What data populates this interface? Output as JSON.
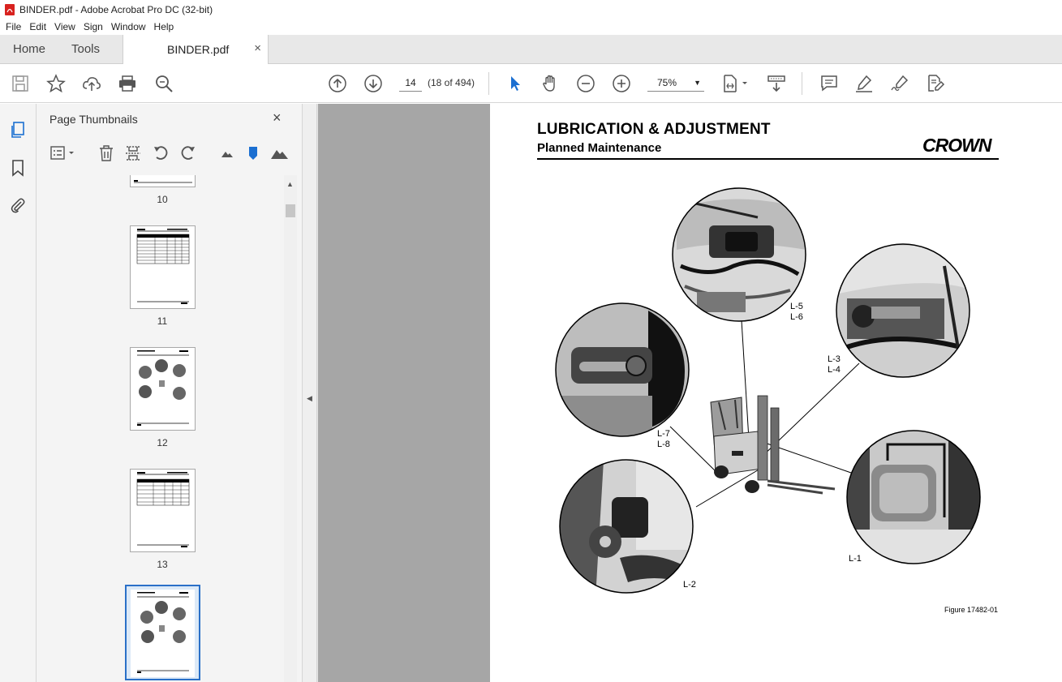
{
  "window": {
    "title": "BINDER.pdf - Adobe Acrobat Pro DC (32-bit)"
  },
  "menu": [
    "File",
    "Edit",
    "View",
    "Sign",
    "Window",
    "Help"
  ],
  "nav_tabs": {
    "home": "Home",
    "tools": "Tools"
  },
  "doc_tab": {
    "name": "BINDER.pdf",
    "close": "×"
  },
  "toolbar": {
    "page_number": "14",
    "page_count": "(18 of 494)",
    "zoom": "75%",
    "icons": [
      "save-icon",
      "star-icon",
      "upload-icon",
      "print-icon",
      "zoom-search-icon",
      "prev-page-icon",
      "next-page-icon",
      "select-cursor-icon",
      "hand-icon",
      "zoom-out-icon",
      "zoom-in-icon",
      "page-layout-icon",
      "scroll-mode-icon",
      "comment-icon",
      "highlight-icon",
      "sign-icon",
      "edit-pdf-icon"
    ]
  },
  "thumbnails_panel": {
    "title": "Page Thumbnails",
    "close": "×",
    "labels": [
      "10",
      "11",
      "12",
      "13"
    ]
  },
  "page": {
    "title": "LUBRICATION & ADJUSTMENT",
    "subtitle": "Planned Maintenance",
    "logo_text": "CROWN",
    "callouts": {
      "l5l6": "L-5\nL-6",
      "l3l4": "L-3\nL-4",
      "l7l8": "L-7\nL-8",
      "l1": "L-1",
      "l2": "L-2"
    },
    "figure_caption": "Figure 17482-01"
  }
}
